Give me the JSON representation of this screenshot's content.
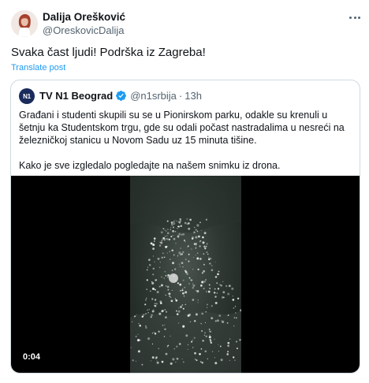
{
  "tweet": {
    "author_name": "Dalija Orešković",
    "author_handle": "@OreskovicDalija",
    "text": "Svaka čast ljudi! Podrška iz Zagreba!",
    "translate_label": "Translate post",
    "more_icon": "more-horizontal-icon"
  },
  "quote": {
    "avatar_text": "N1",
    "name": "TV N1 Beograd",
    "verified_icon": "verified-badge-icon",
    "verified_color": "#1d9bf0",
    "handle": "@n1srbija",
    "separator": "·",
    "time": "13h",
    "paragraph_1": "Građani i studenti skupili su se u Pionirskom parku, odakle su krenuli u šetnju ka Studentskom trgu, gde su odali počast nastradalima u nesreći na železničkoj stanicu u Novom Sadu uz 15 minuta tišine.",
    "paragraph_2": "Kako je sve izgledalo pogledajte na našem snimku iz drona.",
    "video_timestamp": "0:04"
  },
  "colors": {
    "link": "#1d9bf0",
    "secondary_text": "#536471",
    "border": "#cfd9de"
  }
}
